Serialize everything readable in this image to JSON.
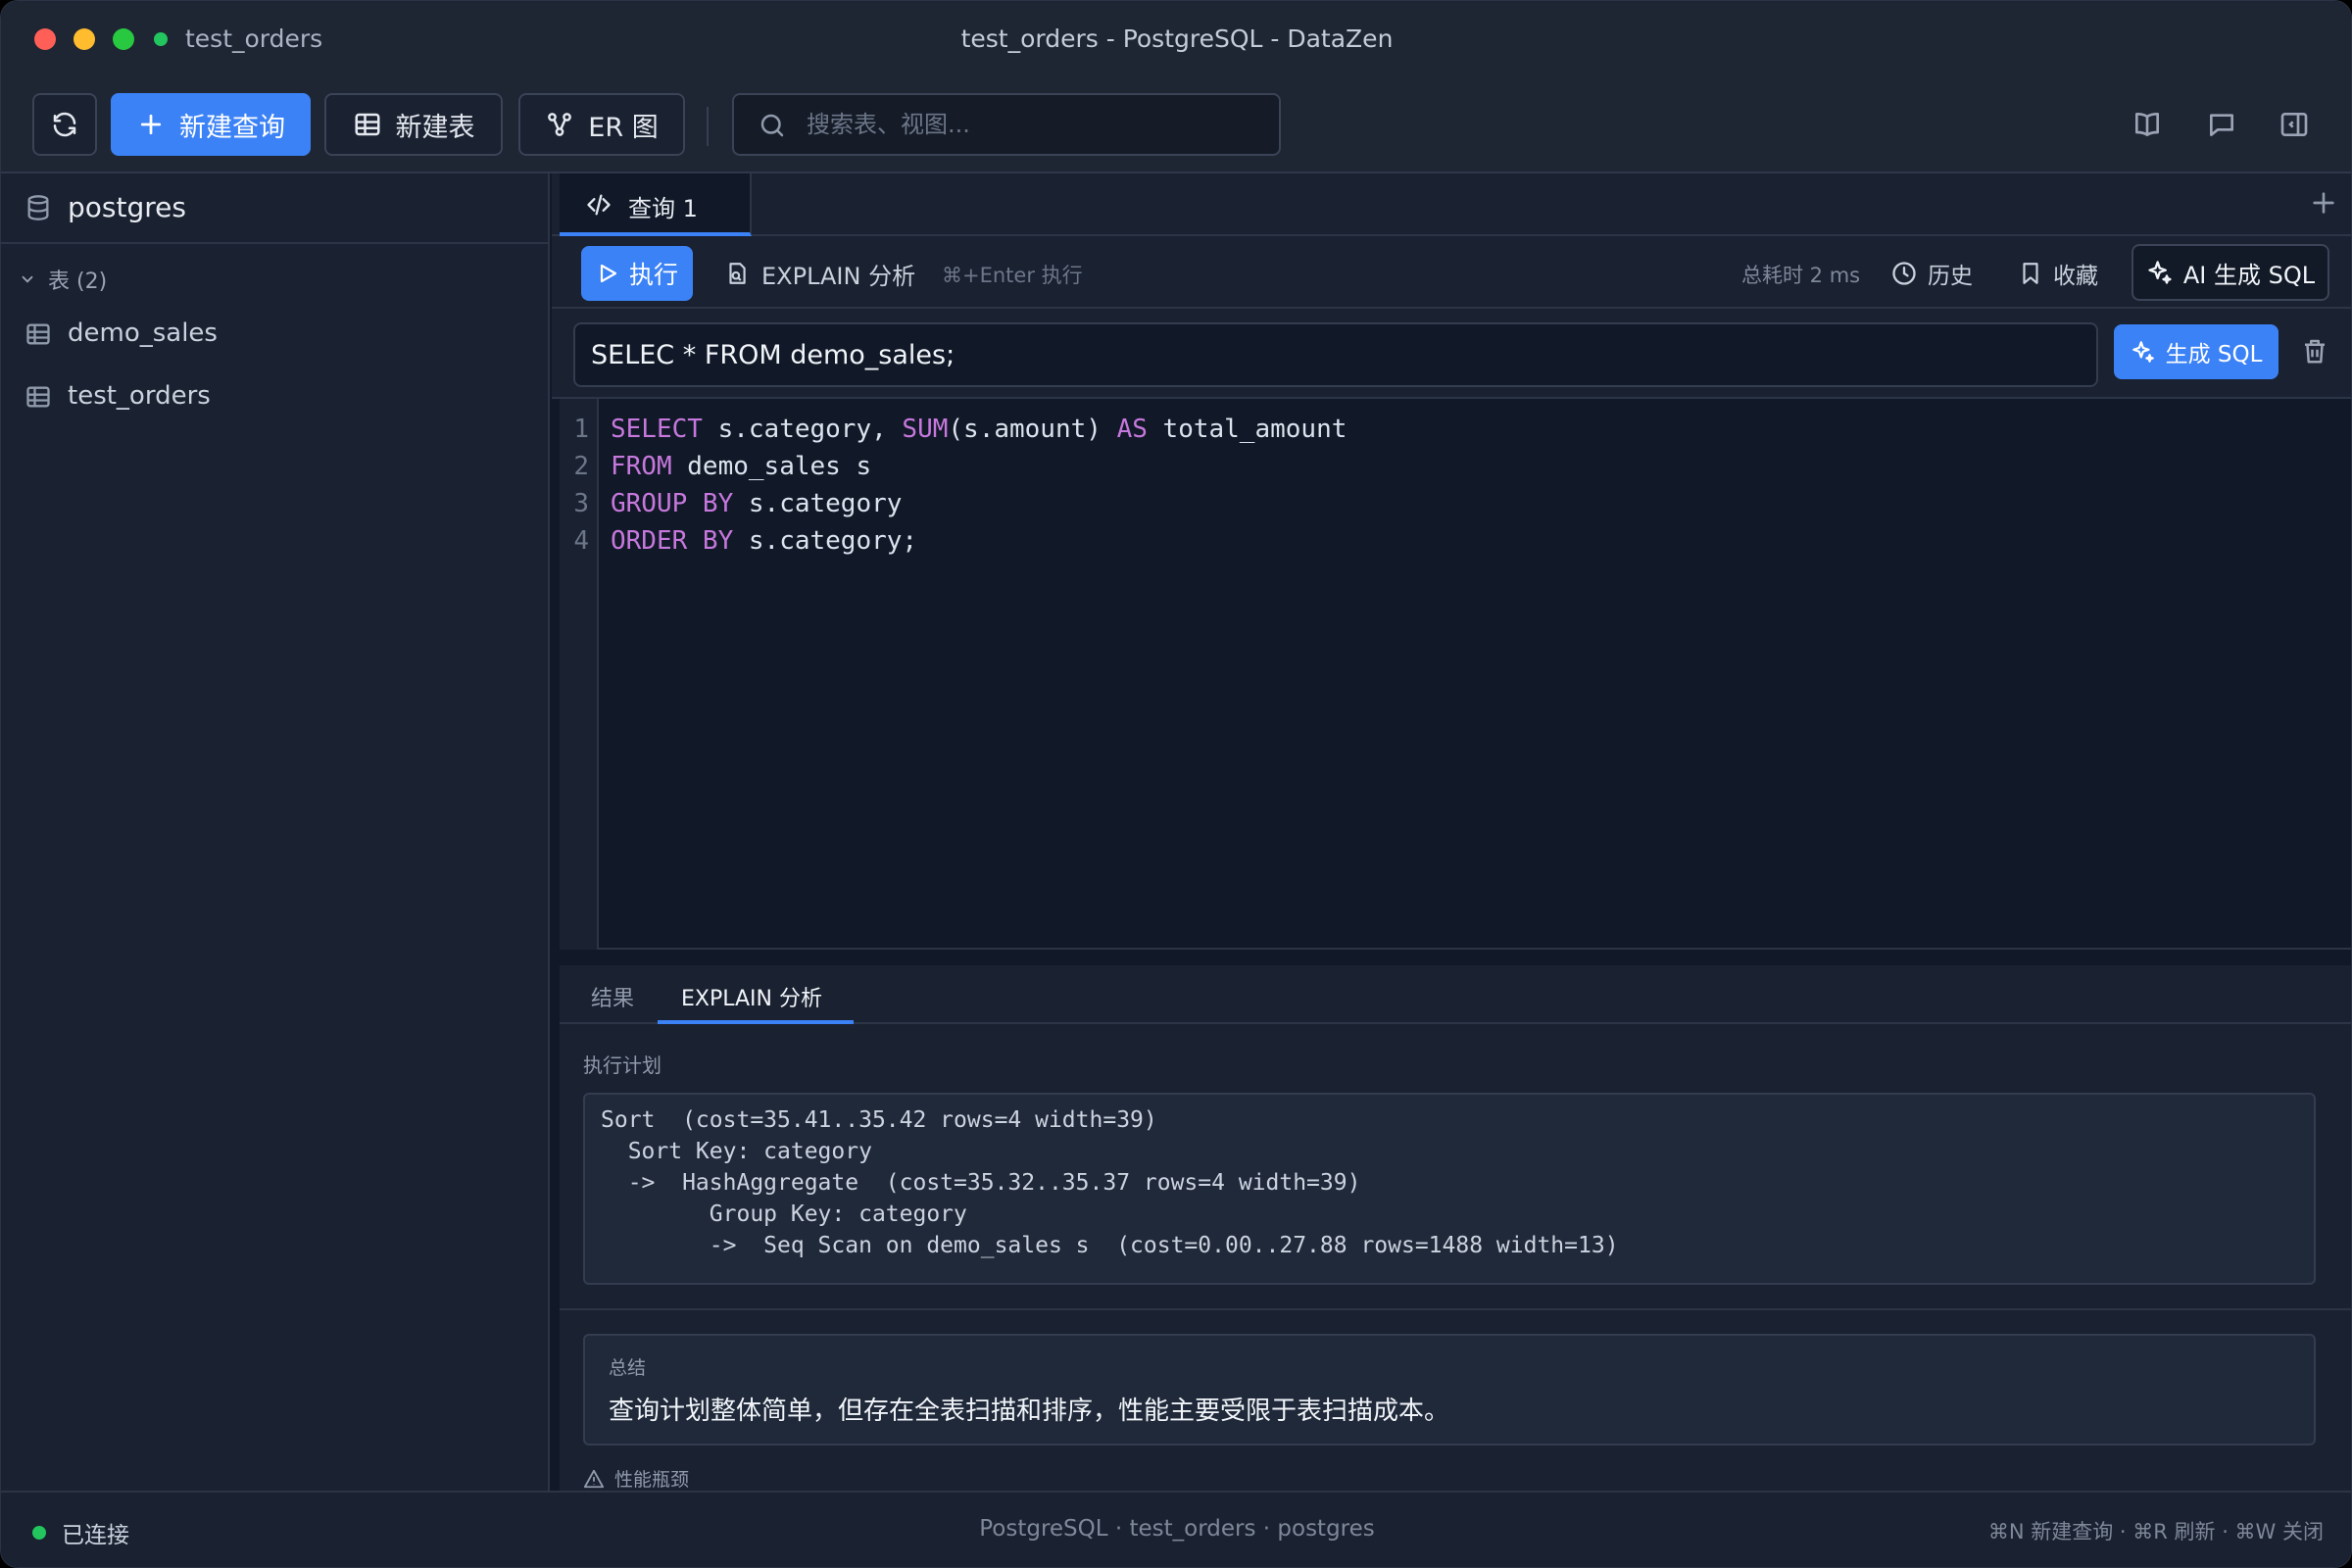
{
  "titlebar": {
    "connection": "test_orders",
    "window_title": "test_orders - PostgreSQL - DataZen"
  },
  "toolbar": {
    "new_query_label": "新建查询",
    "new_table_label": "新建表",
    "er_label": "ER 图",
    "search_placeholder": "搜索表、视图...",
    "icons": [
      "refresh-icon",
      "plus-icon",
      "table-icon",
      "er-diagram-icon",
      "search-icon",
      "book-icon",
      "chat-icon",
      "sidebar-toggle-icon"
    ]
  },
  "sidebar": {
    "database": "postgres",
    "tables_group": "表 (2)",
    "tables": [
      "demo_sales",
      "test_orders"
    ]
  },
  "tabs": [
    {
      "label": "查询 1",
      "active": true
    }
  ],
  "query_toolbar": {
    "run_label": "执行",
    "explain_label": "EXPLAIN 分析",
    "shortcut_hint": "⌘+Enter 执行",
    "elapsed": "总耗时 2 ms",
    "history_label": "历史",
    "favorites_label": "收藏",
    "ai_sql_label": "AI 生成 SQL"
  },
  "nl_query": {
    "value": "SELEC * FROM demo_sales;",
    "generate_label": "生成 SQL"
  },
  "editor": {
    "line_numbers": [
      "1",
      "2",
      "3",
      "4"
    ],
    "lines": [
      {
        "kw1": "SELECT",
        "t1": " s.category, ",
        "kw2": "SUM",
        "t2": "(s.amount) ",
        "kw3": "AS",
        "t3": " total_amount"
      },
      {
        "kw1": "FROM",
        "t1": " demo_sales s"
      },
      {
        "kw1": "GROUP BY",
        "t1": " s.category"
      },
      {
        "kw1": "ORDER BY",
        "t1": " s.category;"
      }
    ]
  },
  "result_tabs": {
    "results": "结果",
    "explain": "EXPLAIN 分析",
    "active": "explain"
  },
  "explain": {
    "plan_label": "执行计划",
    "plan_text": "Sort  (cost=35.41..35.42 rows=4 width=39)\n  Sort Key: category\n  ->  HashAggregate  (cost=35.32..35.37 rows=4 width=39)\n        Group Key: category\n        ->  Seq Scan on demo_sales s  (cost=0.00..27.88 rows=1488 width=13)",
    "summary_label": "总结",
    "summary_text": "查询计划整体简单，但存在全表扫描和排序，性能主要受限于表扫描成本。",
    "bottleneck_label": "性能瓶颈"
  },
  "statusbar": {
    "status": "已连接",
    "center": "PostgreSQL · test_orders · postgres",
    "shortcuts": "⌘N 新建查询 · ⌘R 刷新 · ⌘W 关闭"
  },
  "colors": {
    "accent": "#3b82f6",
    "connected": "#22c55e",
    "keyword": "#c678dd",
    "background": "#111827",
    "panel": "#1a2130"
  }
}
